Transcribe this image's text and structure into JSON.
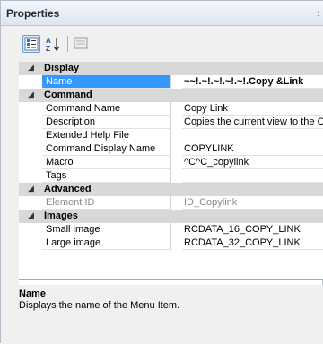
{
  "palette": {
    "title": "Properties"
  },
  "toolbar": {
    "categorized_label": "Categorized",
    "alphabetical_label": "Alphabetical",
    "pages_label": "Property Pages"
  },
  "categories": [
    {
      "label": "Display",
      "toggle": "◢"
    },
    {
      "label": "Command",
      "toggle": "◢"
    },
    {
      "label": "Advanced",
      "toggle": "◢"
    },
    {
      "label": "Images",
      "toggle": "◢"
    }
  ],
  "properties": {
    "name": {
      "name": "Name",
      "value": "~~!.~!.~!.~!.~!.Copy &Link"
    },
    "command_name": {
      "name": "Command Name",
      "value": "Copy Link"
    },
    "description": {
      "name": "Description",
      "value": "Copies the current view to the Clipboard"
    },
    "extended_help": {
      "name": "Extended Help File",
      "value": ""
    },
    "display_name": {
      "name": "Command Display Name",
      "value": "COPYLINK"
    },
    "macro": {
      "name": "Macro",
      "value": "^C^C_copylink"
    },
    "tags": {
      "name": "Tags",
      "value": ""
    },
    "element_id": {
      "name": "Element ID",
      "value": "ID_Copylink"
    },
    "small_image": {
      "name": "Small image",
      "value": "RCDATA_16_COPY_LINK"
    },
    "large_image": {
      "name": "Large image",
      "value": "RCDATA_32_COPY_LINK"
    }
  },
  "description_panel": {
    "title": "Name",
    "text": "Displays the name of the Menu Item."
  },
  "colors": {
    "selection": "#3399ff",
    "category_bg": "#d8d8d8",
    "panel_bg": "#f0f0f0"
  }
}
